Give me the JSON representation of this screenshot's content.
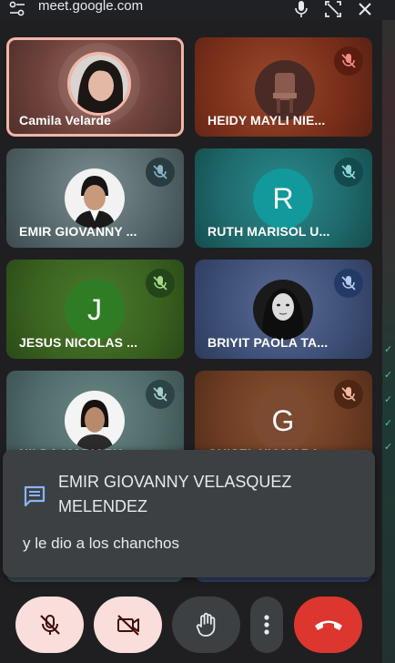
{
  "browser": {
    "url": "meet.google.com",
    "icons": [
      "site-settings-icon",
      "microphone-icon",
      "picture-in-picture-icon",
      "close-icon"
    ]
  },
  "participants": [
    {
      "name": "Camila Velarde",
      "type": "photo",
      "muted": false,
      "speaking": true,
      "bg": "#7d4d45"
    },
    {
      "name": "HEIDY MAYLI NIE...",
      "type": "photo",
      "muted": true,
      "bg": "#8a3a22"
    },
    {
      "name": "EMIR GIOVANNY ...",
      "type": "photo",
      "muted": true,
      "bg": "#566a6d"
    },
    {
      "name": "RUTH MARISOL U...",
      "type": "initial",
      "initial": "R",
      "muted": true,
      "bg": "#1f6a6c",
      "avatar_color": "#12999b"
    },
    {
      "name": "JESUS NICOLAS ...",
      "type": "initial",
      "initial": "J",
      "muted": true,
      "bg": "#3c6a22",
      "avatar_color": "#2e7d24"
    },
    {
      "name": "BRIYIT PAOLA TA...",
      "type": "photo",
      "muted": true,
      "bg": "#3a4e78"
    },
    {
      "name": "NILDA MARIORY ...",
      "type": "photo",
      "muted": true,
      "bg": "#4f6b6a"
    },
    {
      "name": "GUISEL XIOMARA ...",
      "type": "initial",
      "initial": "G",
      "muted": true,
      "bg": "#6e3d23",
      "avatar_color": "#7b4a30"
    }
  ],
  "chat_notification": {
    "sender": "EMIR GIOVANNY VELASQUEZ MELENDEZ",
    "message": "y le dio a los chanchos",
    "icon": "chat-icon"
  },
  "controls": [
    {
      "name": "mic-off",
      "color": "#f9dedc"
    },
    {
      "name": "camera-off",
      "color": "#f9dedc"
    },
    {
      "name": "raise-hand",
      "color": "#3c4043"
    },
    {
      "name": "more-options",
      "color": "#3c4043"
    },
    {
      "name": "leave-call",
      "color": "#dc362e"
    }
  ]
}
